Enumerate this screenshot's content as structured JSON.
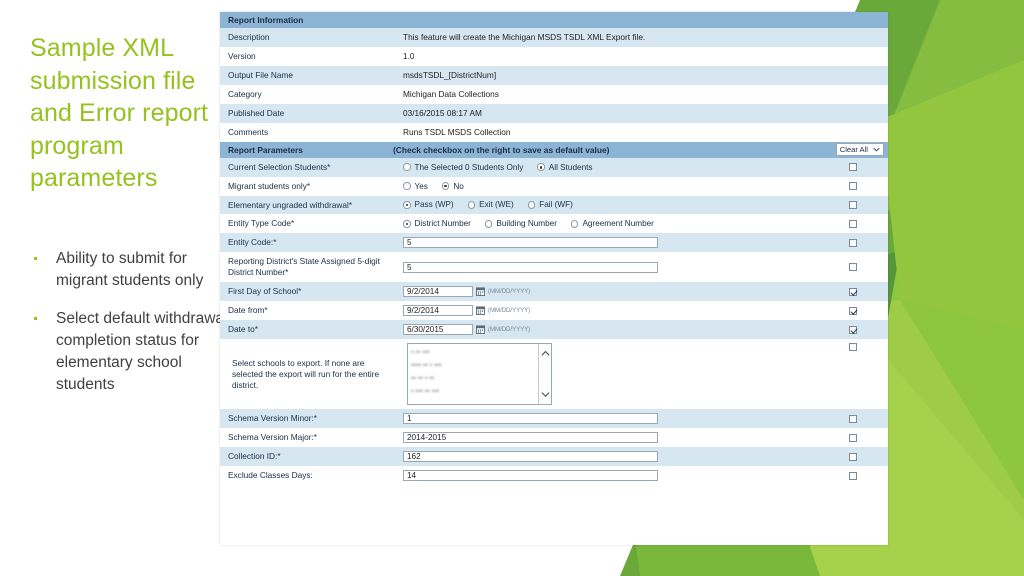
{
  "slide": {
    "title": "Sample XML submission file and Error report program parameters",
    "bullets": [
      "Ability to submit for migrant students only",
      "Select default withdrawal completion status for elementary school students"
    ],
    "accent_color": "#96c11e",
    "text_color": "#404040"
  },
  "form": {
    "report_information": {
      "section_title": "Report Information",
      "rows": [
        {
          "label": "Description",
          "value": "This feature will create the Michigan MSDS TSDL XML Export file."
        },
        {
          "label": "Version",
          "value": "1.0"
        },
        {
          "label": "Output File Name",
          "value": "msdsTSDL_[DistrictNum]"
        },
        {
          "label": "Category",
          "value": "Michigan Data Collections"
        },
        {
          "label": "Published Date",
          "value": "03/16/2015 08:17 AM"
        },
        {
          "label": "Comments",
          "value": "Runs TSDL MSDS Collection"
        }
      ]
    },
    "report_parameters": {
      "section_title": "Report Parameters",
      "section_note": "(Check checkbox on the right to save as default value)",
      "clear_all_label": "Clear All",
      "rows": {
        "current_selection": {
          "label": "Current Selection Students*",
          "options": [
            {
              "text_before": "The Selected ",
              "highlight": "0",
              "text_after": " Students Only",
              "selected": false
            },
            {
              "text_before": "All Students",
              "highlight": "",
              "text_after": "",
              "selected": true
            }
          ],
          "save_default": false
        },
        "migrant_only": {
          "label": "Migrant students only*",
          "options": [
            {
              "text_before": "Yes",
              "highlight": "",
              "text_after": "",
              "selected": false
            },
            {
              "text_before": "No",
              "highlight": "",
              "text_after": "",
              "selected": true
            }
          ],
          "save_default": false
        },
        "elementary_withdrawal": {
          "label": "Elementary ungraded withdrawal*",
          "options": [
            {
              "text_before": "Pass (WP)",
              "highlight": "",
              "text_after": "",
              "selected": true
            },
            {
              "text_before": "Exit (WE)",
              "highlight": "",
              "text_after": "",
              "selected": false
            },
            {
              "text_before": "Fail (WF)",
              "highlight": "",
              "text_after": "",
              "selected": false
            }
          ],
          "save_default": false
        },
        "entity_type_code": {
          "label": "Entity Type Code*",
          "options": [
            {
              "text_before": "District Number",
              "highlight": "",
              "text_after": "",
              "selected": true
            },
            {
              "text_before": "Building Number",
              "highlight": "",
              "text_after": "",
              "selected": false
            },
            {
              "text_before": "Agreement Number",
              "highlight": "",
              "text_after": "",
              "selected": false
            }
          ],
          "save_default": false
        },
        "entity_code": {
          "label": "Entity Code:*",
          "value": "5",
          "save_default": false
        },
        "reporting_district": {
          "label": "Reporting District's State Assigned 5-digit District Number*",
          "value": "5",
          "save_default": false
        },
        "first_day_of_school": {
          "label": "First Day of School*",
          "value": "9/2/2014",
          "format_hint": "(MM/DD/YYYY)",
          "save_default": true
        },
        "date_from": {
          "label": "Date from*",
          "value": "9/2/2014",
          "format_hint": "(MM/DD/YYYY)",
          "save_default": true
        },
        "date_to": {
          "label": "Date to*",
          "value": "6/30/2015",
          "format_hint": "(MM/DD/YYYY)",
          "save_default": true
        },
        "select_schools": {
          "label": "Select schools to export. If none are selected the export will run for the entire district.",
          "save_default": false
        },
        "schema_version_minor": {
          "label": "Schema Version Minor:*",
          "value": "1",
          "save_default": false
        },
        "schema_version_major": {
          "label": "Schema Version Major:*",
          "value": "2014-2015",
          "save_default": false
        },
        "collection_id": {
          "label": "Collection ID:*",
          "value": "162",
          "save_default": false
        },
        "exclude_classes_days": {
          "label": "Exclude Classes Days:",
          "value": "14",
          "save_default": false
        }
      }
    }
  },
  "theme": {
    "section_header_bg": "#8cb4d4",
    "alt_row_bg": "#d6e7f2",
    "label_text": "#1c2e44",
    "link_blue": "#1f7fb5"
  }
}
